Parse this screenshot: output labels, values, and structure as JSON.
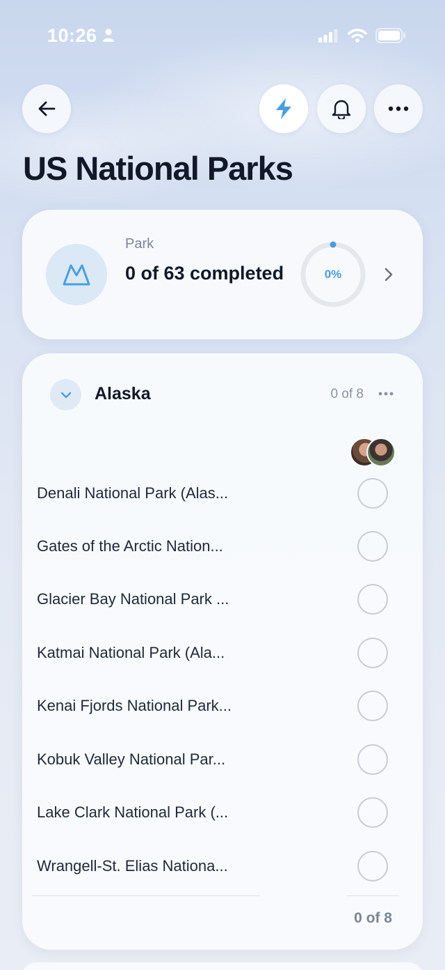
{
  "status_bar": {
    "time": "10:26"
  },
  "header": {
    "title": "US National Parks"
  },
  "summary": {
    "type_label": "Park",
    "completed_text": "0 of 63 completed",
    "progress_text": "0%",
    "progress": 0
  },
  "group": {
    "title": "Alaska",
    "count_top": "0 of 8",
    "count_bottom": "0 of 8",
    "items": [
      {
        "name": "Denali National Park (Alas...",
        "done": false
      },
      {
        "name": "Gates of the Arctic Nation...",
        "done": false
      },
      {
        "name": "Glacier Bay National Park ...",
        "done": false
      },
      {
        "name": "Katmai National Park (Ala...",
        "done": false
      },
      {
        "name": "Kenai Fjords National Park...",
        "done": false
      },
      {
        "name": "Kobuk Valley National Par...",
        "done": false
      },
      {
        "name": "Lake Clark National Park (...",
        "done": false
      },
      {
        "name": "Wrangell-St. Elias Nationa...",
        "done": false
      }
    ]
  },
  "colors": {
    "accent": "#4a9ee0",
    "ring_track": "#e4e7ec",
    "icon_bg": "#dbe8f6"
  }
}
